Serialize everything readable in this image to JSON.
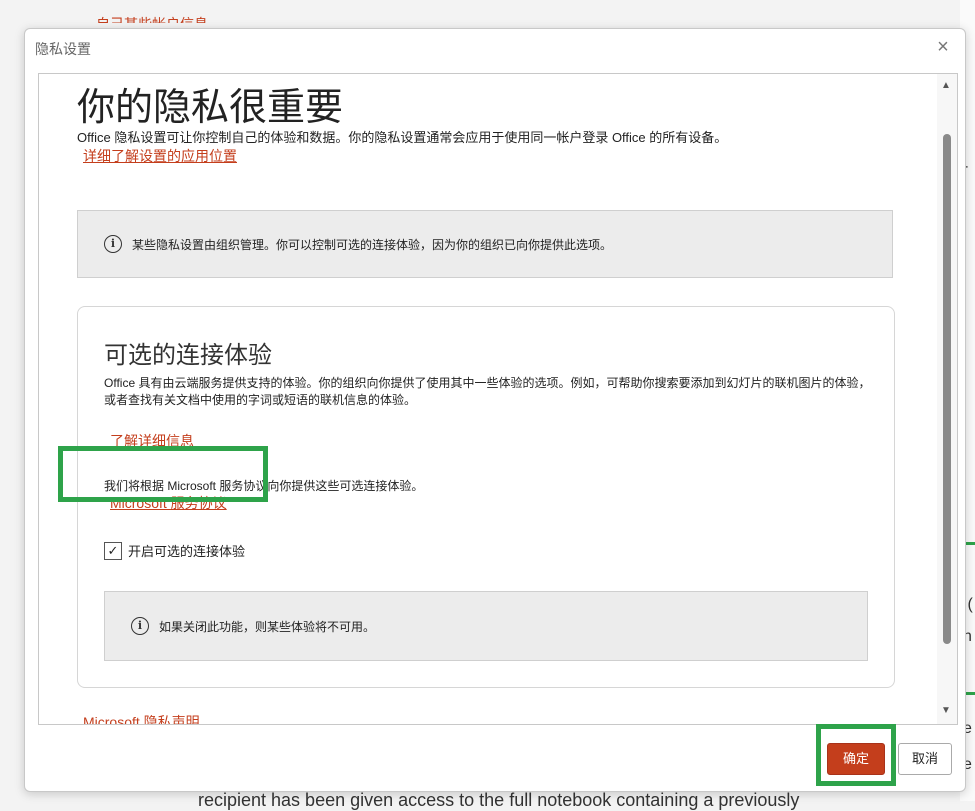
{
  "dialog": {
    "title": "隐私设置",
    "close_label": "×",
    "heading": "你的隐私很重要",
    "intro": "Office 隐私设置可让你控制自己的体验和数据。你的隐私设置通常会应用于使用同一帐户登录 Office 的所有设备。",
    "intro_link": "详细了解设置的应用位置",
    "org_notice": "某些隐私设置由组织管理。你可以控制可选的连接体验，因为你的组织已向你提供此选项。",
    "connected": {
      "title": "可选的连接体验",
      "description": "Office 具有由云端服务提供支持的体验。你的组织向你提供了使用其中一些体验的选项。例如，可帮助你搜索要添加到幻灯片的联机图片的体验，或者查找有关文档中使用的字词或短语的联机信息的体验。",
      "learn_more_link": "了解详细信息",
      "agreement_text": "我们将根据 Microsoft 服务协议向你提供这些可选连接体验。",
      "ms_agreement_link": "Microsoft 服务协议",
      "checkbox_label": "开启可选的连接体验",
      "checkbox_checked": true,
      "checkbox_mark": "✓",
      "off_notice": "如果关闭此功能，则某些体验将不可用。"
    },
    "privacy_statement_link": "Microsoft 隐私声明",
    "info_glyph": "i",
    "ok_label": "确定",
    "cancel_label": "取消"
  },
  "background": {
    "top_fragment": "自己某些帐户信息",
    "bottom_fragment": "recipient has been given access to the full notebook containing a previously",
    "right_fragments": [
      "-",
      "ı(",
      "n",
      "e",
      "e"
    ]
  },
  "colors": {
    "accent": "#c43e1c",
    "highlight": "#2ea34a"
  }
}
